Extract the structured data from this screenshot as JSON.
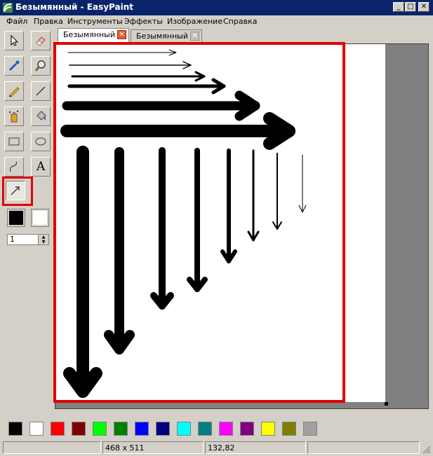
{
  "window": {
    "title": "Безымянный - EasyPaint",
    "minimize": "_",
    "maximize": "□",
    "close": "✕"
  },
  "menu": [
    "Файл",
    "Правка",
    "Инструменты",
    "Эффекты",
    "Изображение",
    "Справка"
  ],
  "tools": [
    "select-icon",
    "eraser-icon",
    "color-picker-icon",
    "magnifier-icon",
    "pencil-icon",
    "line-icon",
    "spray-icon",
    "fill-icon",
    "rectangle-icon",
    "ellipse-icon",
    "curve-icon",
    "text-icon",
    "arrow-icon"
  ],
  "text_tool_label": "A",
  "colors": {
    "primary": "#000000",
    "secondary": "#ffffff"
  },
  "pen_size": "1",
  "tabs": [
    {
      "label": "Безымянный",
      "active": true
    },
    {
      "label": "Безымянный",
      "active": false
    }
  ],
  "palette": [
    "#000000",
    "#ffffff",
    "#ff0000",
    "#800000",
    "#00ff00",
    "#008000",
    "#0000ff",
    "#000080",
    "#00ffff",
    "#008080",
    "#ff00ff",
    "#800080",
    "#ffff00",
    "#808000",
    "#a0a0a0"
  ],
  "status": {
    "size": "468 x 511",
    "cursor": "132,82",
    "extra": ""
  }
}
